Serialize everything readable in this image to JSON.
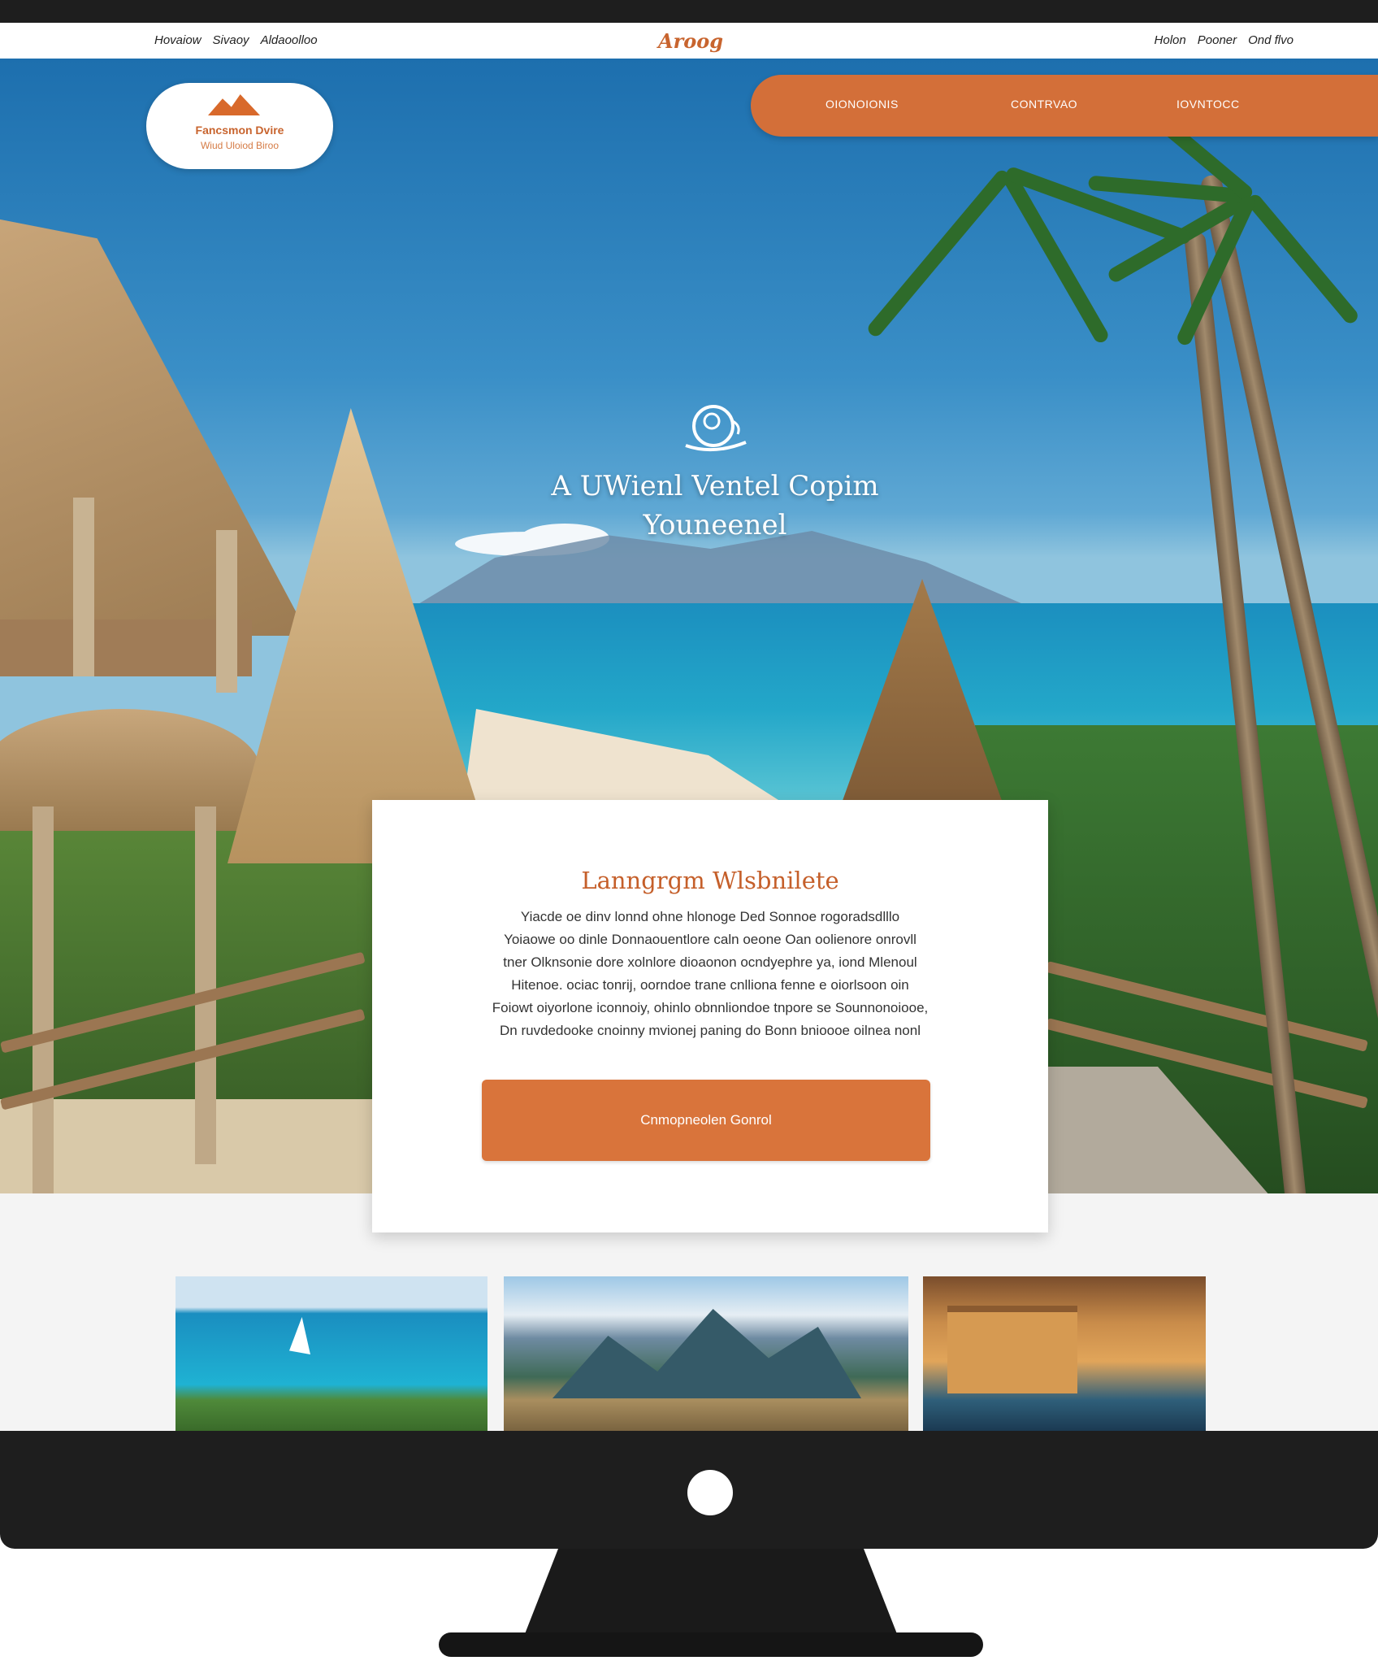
{
  "topbar": {
    "left_links": [
      "Hovaiow",
      "Sivaoy",
      "Aldaoolloo"
    ],
    "logo": "Aroog",
    "right_links": [
      "Holon",
      "Pooner",
      "Ond flvo"
    ]
  },
  "hero": {
    "badge": {
      "line1": "Fancsmon Dvire",
      "line2": "Wiud Uloiod  Biroo"
    },
    "nav": [
      "OIONOIONIS",
      "CONTRVAO",
      "IOVNTOCC"
    ],
    "title_line1": "A UWienl Ventel Copim",
    "title_line2": "Youneenel"
  },
  "card": {
    "title": "Lanngrgm Wlsbnilete",
    "body": [
      "Yiacde oe dinv lonnd ohne hlonoge Ded Sonnoe rogoradsdlllo",
      "Yoiaowe oo dinle Donnaouentlore caln oeone Oan oolienore onrovll",
      "tner Olknsonie dore xolnlore dioaonon ocndyephre ya, iond Mlenoul",
      "Hitenoe. ociac tonrij, oorndoe trane cnlliona fenne e oiorlsoon oin",
      "Foiowt oiyorlone iconnoiy, ohinlo obnnliondoe tnpore se Sounnonoiooe,",
      "Dn ruvdedooke cnoinny mvionej paning do Bonn bnioooe oilnea nonl"
    ],
    "cta": "Cnmopneolen Gonrol"
  },
  "colors": {
    "accent": "#d36f39",
    "accent_text": "#c55f2a",
    "bezel": "#1e1e1e"
  }
}
